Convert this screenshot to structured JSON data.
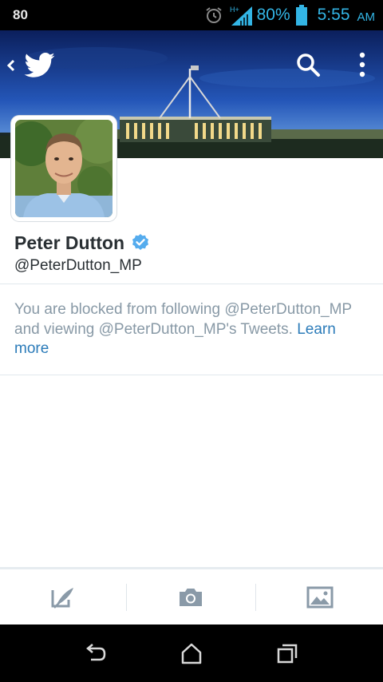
{
  "status_bar": {
    "notification_count": "80",
    "network_type": "H+",
    "battery_percent": "80%",
    "time": "5:55",
    "ampm": "AM",
    "icons": [
      "alarm-icon",
      "signal-icon",
      "battery-icon"
    ]
  },
  "header": {
    "back_icon": "chevron-left-icon",
    "logo_icon": "twitter-bird-icon",
    "search_icon": "search-icon",
    "more_icon": "vertical-dots-icon"
  },
  "profile": {
    "name": "Peter Dutton",
    "handle": "@PeterDutton_MP",
    "verified": true
  },
  "blocked_notice": {
    "message": "You are blocked from following @PeterDutton_MP and viewing @PeterDutton_MP's Tweets.",
    "link": "Learn more"
  },
  "toolbar": {
    "items": [
      "compose-tweet-icon",
      "camera-icon",
      "photo-gallery-icon"
    ]
  },
  "navbar": {
    "items": [
      "back-icon",
      "home-icon",
      "recent-apps-icon"
    ]
  },
  "colors": {
    "accent": "#55acee",
    "link": "#2b7bb9",
    "muted_text": "#8899a6",
    "status_bar_text": "#33b5e5"
  }
}
